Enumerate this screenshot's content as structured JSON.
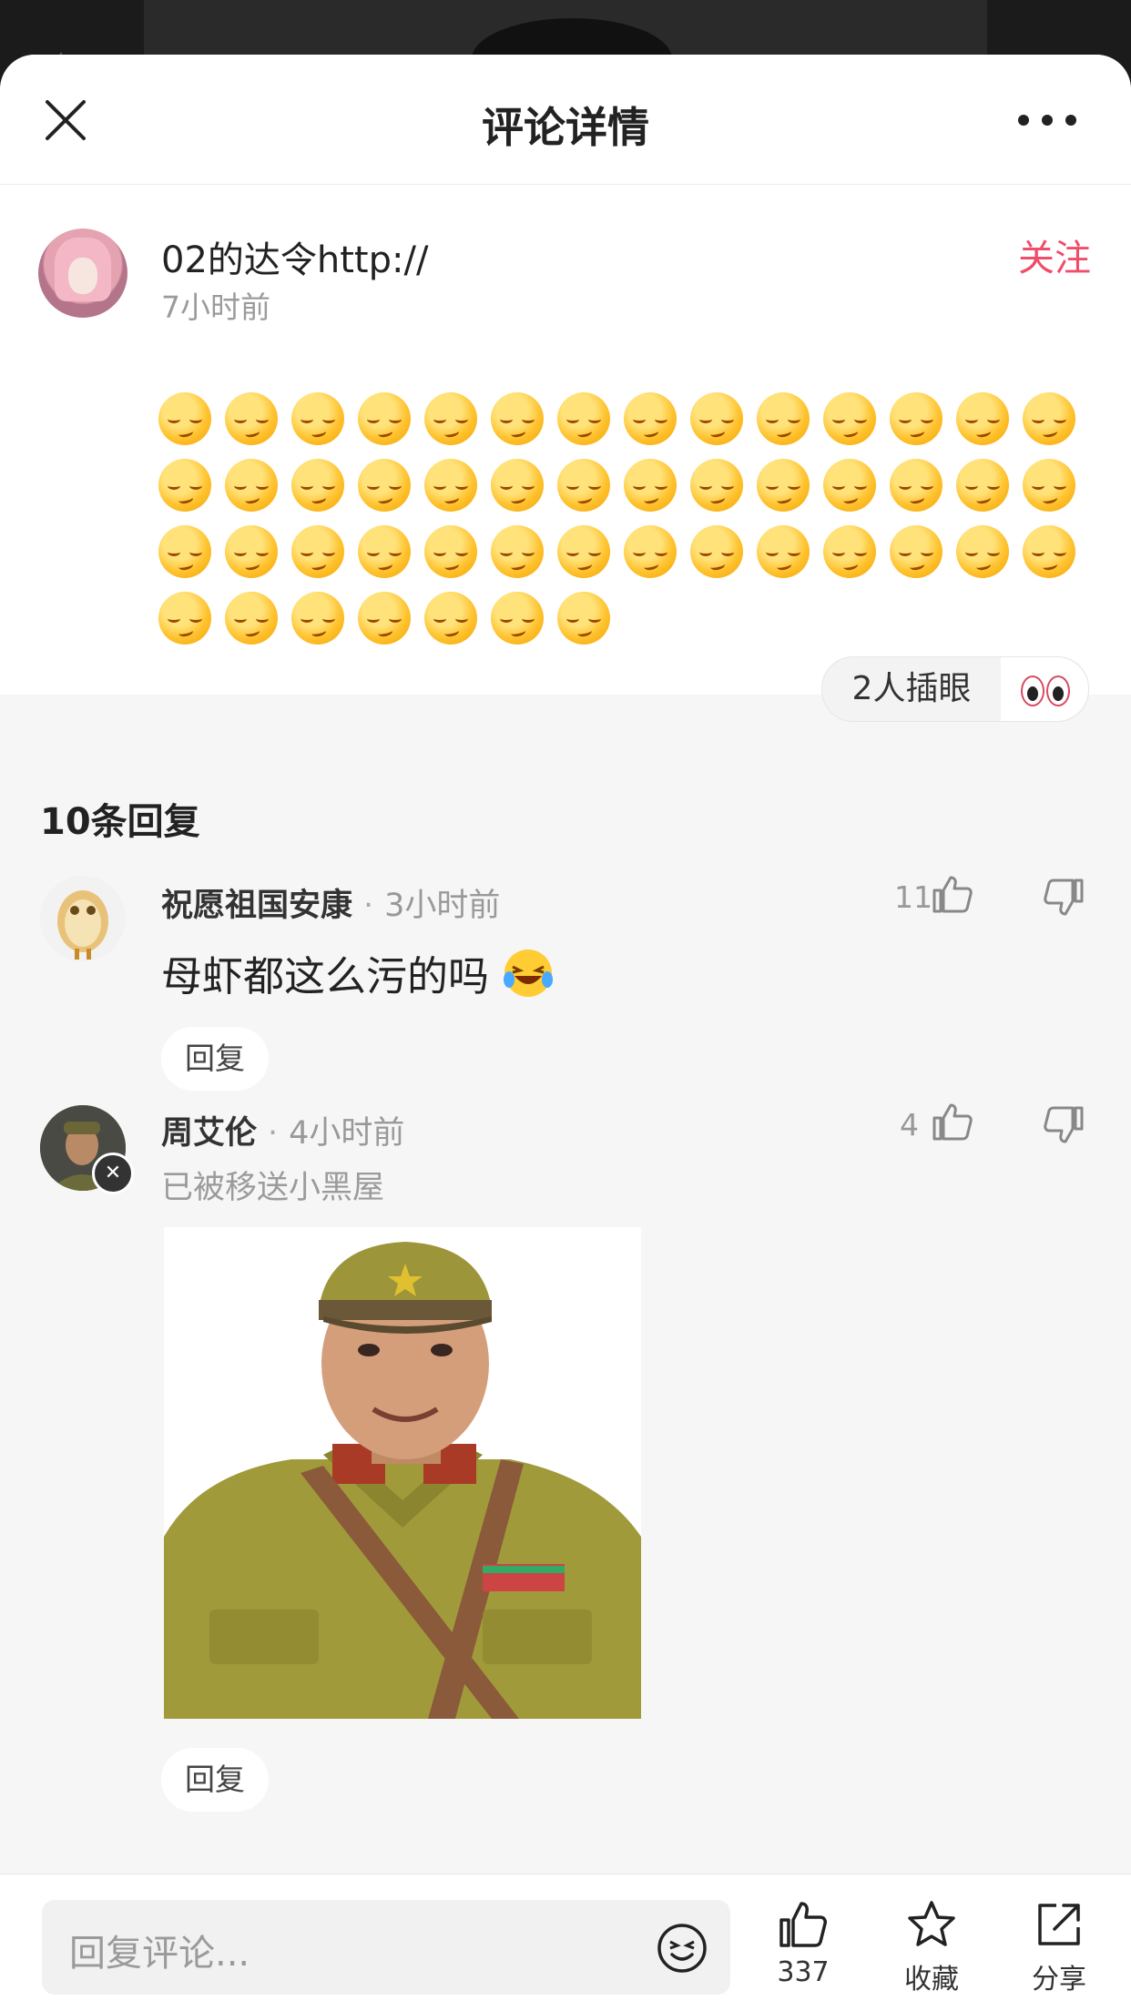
{
  "header": {
    "title": "评论详情"
  },
  "main_comment": {
    "author": "02的达令http://",
    "time": "7小时前",
    "follow_label": "关注",
    "emoji_rows": [
      14,
      14,
      14,
      7
    ],
    "peek_text": "2人插眼"
  },
  "replies_header": "10条回复",
  "replies": [
    {
      "author": "祝愿祖国安康",
      "time": "3小时前",
      "likes": "11",
      "text": "母虾都这么污的吗",
      "reply_label": "回复"
    },
    {
      "author": "周艾伦",
      "time": "4小时前",
      "likes": "4",
      "sub": "已被移送小黑屋",
      "reply_label": "回复"
    }
  ],
  "bottom_bar": {
    "input_placeholder": "回复评论...",
    "like_count": "337",
    "favorite_label": "收藏",
    "share_label": "分享"
  },
  "colors": {
    "accent": "#f04d6b",
    "background": "#f6f6f6"
  }
}
